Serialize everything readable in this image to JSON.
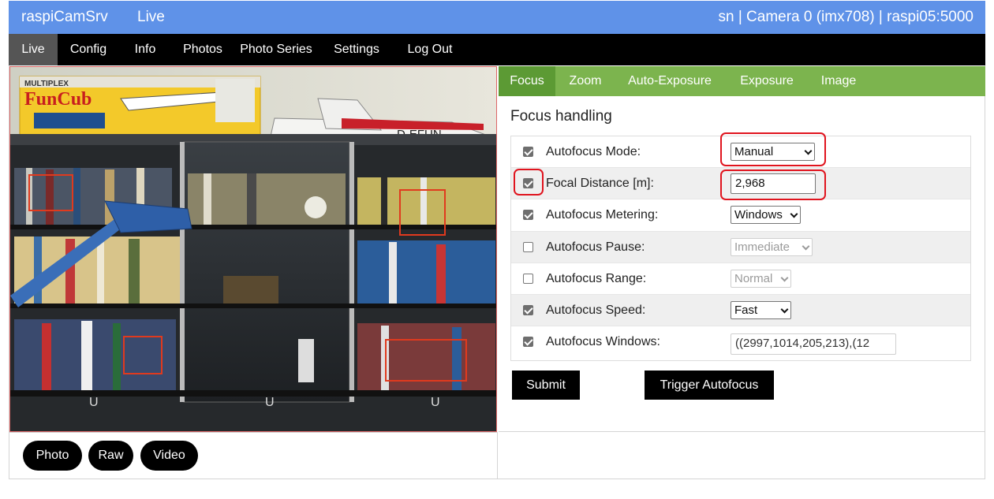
{
  "header": {
    "app_name": "raspiCamSrv",
    "page_name": "Live",
    "status": "sn | Camera 0 (imx708) | raspi05:5000",
    "bg_color": "#5f92e8"
  },
  "nav": {
    "items": [
      "Live",
      "Config",
      "Info",
      "Photos",
      "Photo Series",
      "Settings",
      "Log Out"
    ],
    "active": "Live"
  },
  "camera": {
    "scene_text": {
      "brand": "MULTIPLEX",
      "model": "FunCub",
      "plane_reg": "D-EFUN"
    }
  },
  "capture_buttons": [
    "Photo",
    "Raw",
    "Video"
  ],
  "tabs": {
    "items": [
      "Focus",
      "Zoom",
      "Auto-Exposure",
      "Exposure",
      "Image"
    ],
    "active": "Focus",
    "color": "#7cb44e",
    "active_color": "#5c9a34"
  },
  "focus": {
    "title": "Focus handling",
    "rows": [
      {
        "label": "Autofocus Mode:",
        "checked": true,
        "value": "Manual",
        "type": "select",
        "enabled": true
      },
      {
        "label": "Focal Distance [m]:",
        "checked": true,
        "value": "2,968",
        "type": "text",
        "enabled": true
      },
      {
        "label": "Autofocus Metering:",
        "checked": true,
        "value": "Windows",
        "type": "select",
        "enabled": true
      },
      {
        "label": "Autofocus Pause:",
        "checked": false,
        "value": "Immediate",
        "type": "select",
        "enabled": false
      },
      {
        "label": "Autofocus Range:",
        "checked": false,
        "value": "Normal",
        "type": "select",
        "enabled": false
      },
      {
        "label": "Autofocus Speed:",
        "checked": true,
        "value": "Fast",
        "type": "select",
        "enabled": true
      },
      {
        "label": "Autofocus Windows:",
        "checked": true,
        "value": "((2997,1014,205,213),(12",
        "type": "text",
        "enabled": true
      }
    ],
    "submit_label": "Submit",
    "trigger_label": "Trigger Autofocus"
  },
  "highlight_color": "#e0141e"
}
